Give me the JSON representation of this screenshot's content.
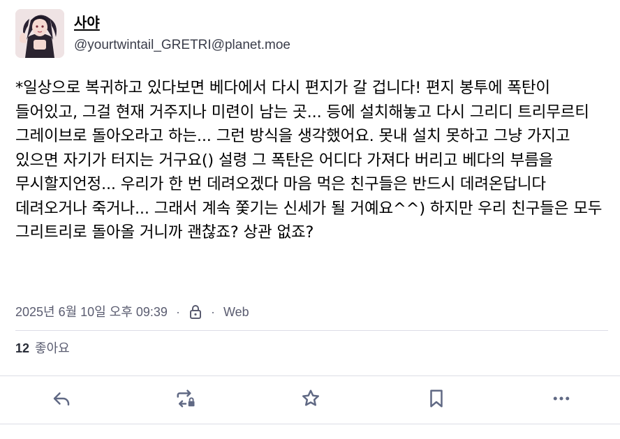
{
  "account": {
    "display_name": "사야",
    "handle": "@yourtwintail_GRETRI@planet.moe",
    "avatar_icon": "avatar-illustration"
  },
  "post": {
    "text": "*일상으로 복귀하고 있다보면 베다에서 다시 편지가 갈 겁니다! 편지 봉투에 폭탄이 들어있고, 그걸 현재 거주지나 미련이 남는 곳... 등에 설치해놓고 다시 그리디 트리무르티 그레이브로 돌아오라고 하는... 그런 방식을 생각했어요. 못내 설치 못하고 그냥 가지고 있으면 자기가 터지는 거구요() 설령 그 폭탄은 어디다 가져다 버리고 베다의 부름을 무시할지언정... 우리가 한 번 데려오겠다 마음 먹은 친구들은 반드시 데려온답니다 데려오거나 죽거나... 그래서 계속 쫓기는 신세가 될 거예요^^) 하지만 우리 친구들은 모두 그리트리로 돌아올 거니까 괜찮죠? 상관 없죠?"
  },
  "meta": {
    "timestamp": "2025년 6월 10일 오후 09:39",
    "separator": "·",
    "visibility_icon": "lock-icon",
    "application": "Web"
  },
  "stats": {
    "favourites_count": "12",
    "favourites_label": "좋아요"
  },
  "actions": {
    "reply_icon": "reply-icon",
    "boost_icon": "boost-locked-icon",
    "favourite_icon": "star-icon",
    "bookmark_icon": "bookmark-icon",
    "more_icon": "more-icon"
  },
  "colors": {
    "icon": "#606984",
    "text": "#000000",
    "muted": "#5a5c70",
    "divider": "#dcdde6"
  }
}
